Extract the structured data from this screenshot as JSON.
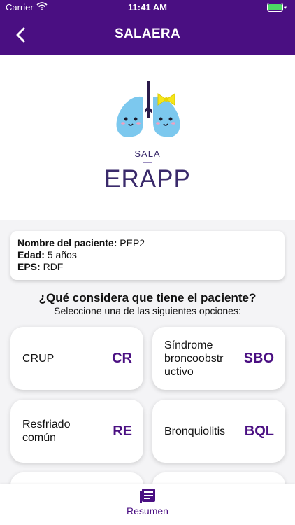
{
  "status_bar": {
    "carrier": "Carrier",
    "time": "11:41 AM"
  },
  "nav": {
    "title": "SALAERA",
    "back_icon": "chevron-left-icon"
  },
  "hero": {
    "sala": "SALA",
    "name": "ERAPP",
    "logo": "lungs-logo"
  },
  "patient": {
    "name_label": "Nombre del paciente:",
    "name_value": "PEP2",
    "age_label": "Edad:",
    "age_value": "5 años",
    "eps_label": "EPS:",
    "eps_value": "RDF"
  },
  "question": "¿Qué considera que tiene el paciente?",
  "instruction": "Seleccione una de las siguientes opciones:",
  "options": [
    {
      "label_lines": [
        "CRUP"
      ],
      "code": "CR"
    },
    {
      "label_lines": [
        "Síndrome",
        "broncoobstr",
        "uctivo"
      ],
      "code": "SBO"
    },
    {
      "label_lines": [
        "Resfriado",
        "común"
      ],
      "code": "RE"
    },
    {
      "label_lines": [
        "Bronquiolitis"
      ],
      "code": "BQL"
    }
  ],
  "tab_bar": {
    "label": "Resumen",
    "icon": "summary-icon"
  },
  "colors": {
    "primary": "#4a0f82",
    "lung_blue": "#7cc8ee",
    "bow_yellow": "#f5e51a"
  }
}
